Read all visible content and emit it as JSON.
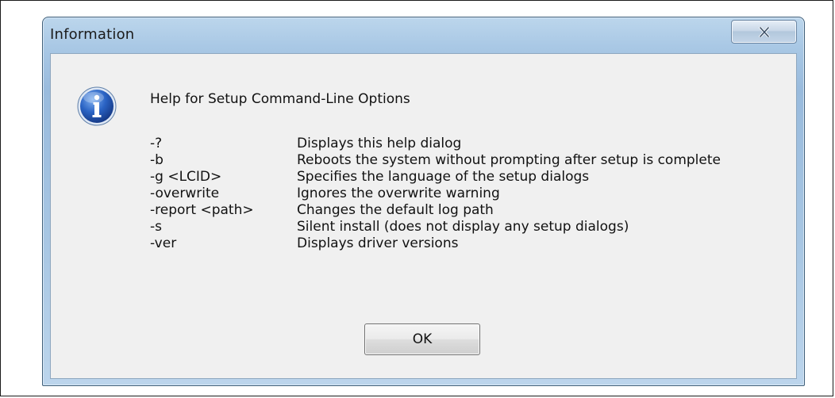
{
  "window": {
    "title": "Information",
    "close_label": "X"
  },
  "dialog": {
    "icon": "information-icon",
    "heading": "Help for Setup Command-Line Options",
    "options": [
      {
        "flag": "-?",
        "description": "Displays this help dialog"
      },
      {
        "flag": "-b",
        "description": "Reboots the system without prompting after setup is complete"
      },
      {
        "flag": "-g <LCID>",
        "description": "Specifies the language of the setup dialogs"
      },
      {
        "flag": "-overwrite",
        "description": "Ignores the overwrite warning"
      },
      {
        "flag": "-report <path>",
        "description": "Changes the default log path"
      },
      {
        "flag": "-s",
        "description": "Silent install (does not display any setup dialogs)"
      },
      {
        "flag": "-ver",
        "description": "Displays driver versions"
      }
    ],
    "ok_label": "OK"
  },
  "colors": {
    "title_bar": "#a9c8e5",
    "client_bg": "#f0f0f0",
    "icon_blue": "#1d4fa8"
  }
}
